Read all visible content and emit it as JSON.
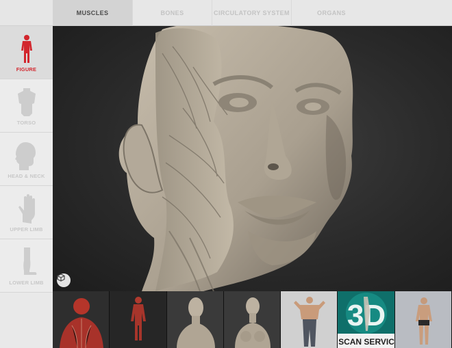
{
  "app": {
    "accent_color": "#d2262d"
  },
  "tabs": [
    {
      "label": "MUSCLES",
      "active": true
    },
    {
      "label": "BONES",
      "active": false
    },
    {
      "label": "CIRCULATORY SYSTEM",
      "active": false
    },
    {
      "label": "ORGANS",
      "active": false
    }
  ],
  "sidebar": {
    "items": [
      {
        "label": "FIGURE",
        "icon": "full-body-icon",
        "active": true
      },
      {
        "label": "TORSO",
        "icon": "torso-icon",
        "active": false
      },
      {
        "label": "HEAD & NECK",
        "icon": "head-profile-icon",
        "active": false
      },
      {
        "label": "UPPER LIMB",
        "icon": "hand-icon",
        "active": false
      },
      {
        "label": "LOWER LIMB",
        "icon": "leg-icon",
        "active": false
      }
    ]
  },
  "viewport": {
    "model": "3D head and neck with facial muscles (écorché)",
    "view_cube_icon": "view-cube-icon"
  },
  "thumbnails": [
    {
      "name": "muscle-figure-bust-thumb",
      "icon": "muscle-bust"
    },
    {
      "name": "muscle-figure-full-thumb",
      "icon": "muscle-figure"
    },
    {
      "name": "male-bust-thumb",
      "icon": "male-bust"
    },
    {
      "name": "female-bust-thumb",
      "icon": "female-bust"
    },
    {
      "name": "male-figure-thumb",
      "icon": "male-figure"
    },
    {
      "name": "3d-scan-service-thumb",
      "icon": "scan-logo"
    },
    {
      "name": "underwear-figure-thumb",
      "icon": "standing-figure"
    }
  ],
  "thumbnail_text": {
    "scan_logo_big": "3D",
    "scan_logo_small": "SCAN SERVIC"
  }
}
